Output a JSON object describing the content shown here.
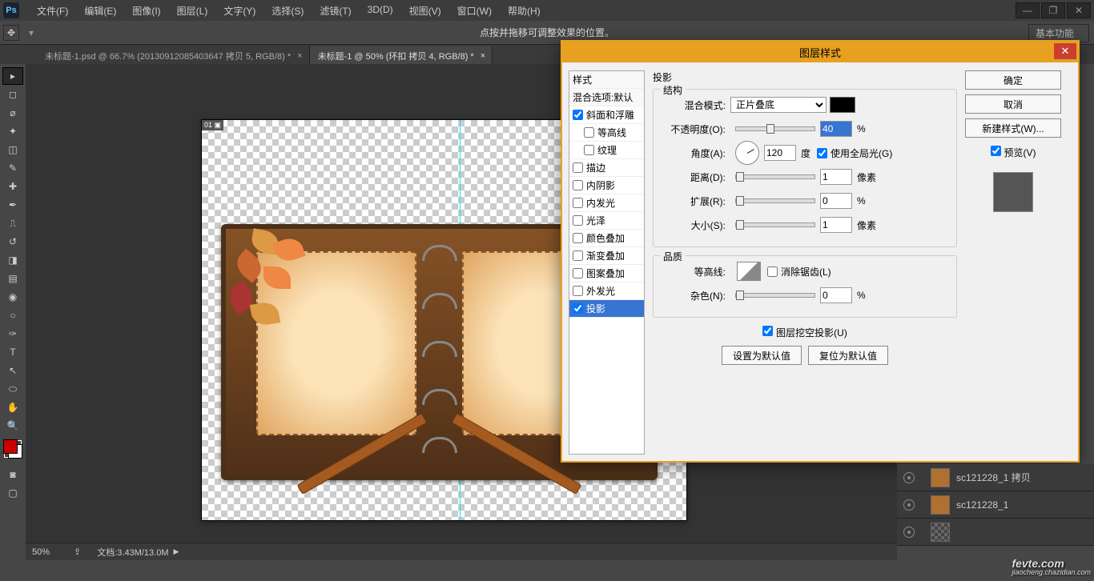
{
  "menu": [
    "文件(F)",
    "编辑(E)",
    "图像(I)",
    "图层(L)",
    "文字(Y)",
    "选择(S)",
    "滤镜(T)",
    "3D(D)",
    "视图(V)",
    "窗口(W)",
    "帮助(H)"
  ],
  "win_buttons": [
    "—",
    "❐",
    "✕"
  ],
  "option_hint": "点按并拖移可调整效果的位置。",
  "option_preset": "基本功能",
  "tabs": [
    {
      "label": "未标题-1.psd @ 66.7% (20130912085403647 拷贝 5, RGB/8) *",
      "active": false
    },
    {
      "label": "未标题-1 @ 50% (环扣 拷贝 4, RGB/8) *",
      "active": true
    }
  ],
  "canvas_badge": "01 ▣",
  "status": {
    "zoom": "50%",
    "doc": "文档:3.43M/13.0M"
  },
  "dialog": {
    "title": "图层样式",
    "style_list": [
      {
        "label": "样式",
        "cb": false,
        "head": true
      },
      {
        "label": "混合选项:默认",
        "cb": false,
        "head": true
      },
      {
        "label": "斜面和浮雕",
        "cb": true,
        "checked": true
      },
      {
        "label": "等高线",
        "cb": true,
        "indent": true
      },
      {
        "label": "纹理",
        "cb": true,
        "indent": true
      },
      {
        "label": "描边",
        "cb": true
      },
      {
        "label": "内阴影",
        "cb": true
      },
      {
        "label": "内发光",
        "cb": true
      },
      {
        "label": "光泽",
        "cb": true
      },
      {
        "label": "颜色叠加",
        "cb": true
      },
      {
        "label": "渐变叠加",
        "cb": true
      },
      {
        "label": "图案叠加",
        "cb": true
      },
      {
        "label": "外发光",
        "cb": true
      },
      {
        "label": "投影",
        "cb": true,
        "checked": true,
        "sel": true
      }
    ],
    "section_title": "投影",
    "struct_legend": "结构",
    "quality_legend": "品质",
    "blend_mode_label": "混合模式:",
    "blend_mode_value": "正片叠底",
    "opacity_label": "不透明度(O):",
    "opacity_value": "40",
    "opacity_unit": "%",
    "angle_label": "角度(A):",
    "angle_value": "120",
    "angle_unit": "度",
    "global_light": "使用全局光(G)",
    "distance_label": "距离(D):",
    "distance_value": "1",
    "distance_unit": "像素",
    "spread_label": "扩展(R):",
    "spread_value": "0",
    "spread_unit": "%",
    "size_label": "大小(S):",
    "size_value": "1",
    "size_unit": "像素",
    "contour_label": "等高线:",
    "antialias": "消除锯齿(L)",
    "noise_label": "杂色(N):",
    "noise_value": "0",
    "noise_unit": "%",
    "knockout": "图层挖空投影(U)",
    "default_set": "设置为默认值",
    "default_reset": "复位为默认值",
    "buttons": {
      "ok": "确定",
      "cancel": "取消",
      "new": "新建样式(W)...",
      "preview": "预览(V)"
    }
  },
  "layers": [
    {
      "name": "sc121228_1 拷贝",
      "img": true
    },
    {
      "name": "sc121228_1",
      "img": true
    },
    {
      "name": "",
      "img": false
    }
  ],
  "watermark": {
    "main": "fevte.com",
    "sub": "jiaocheng.chazidian.com"
  }
}
